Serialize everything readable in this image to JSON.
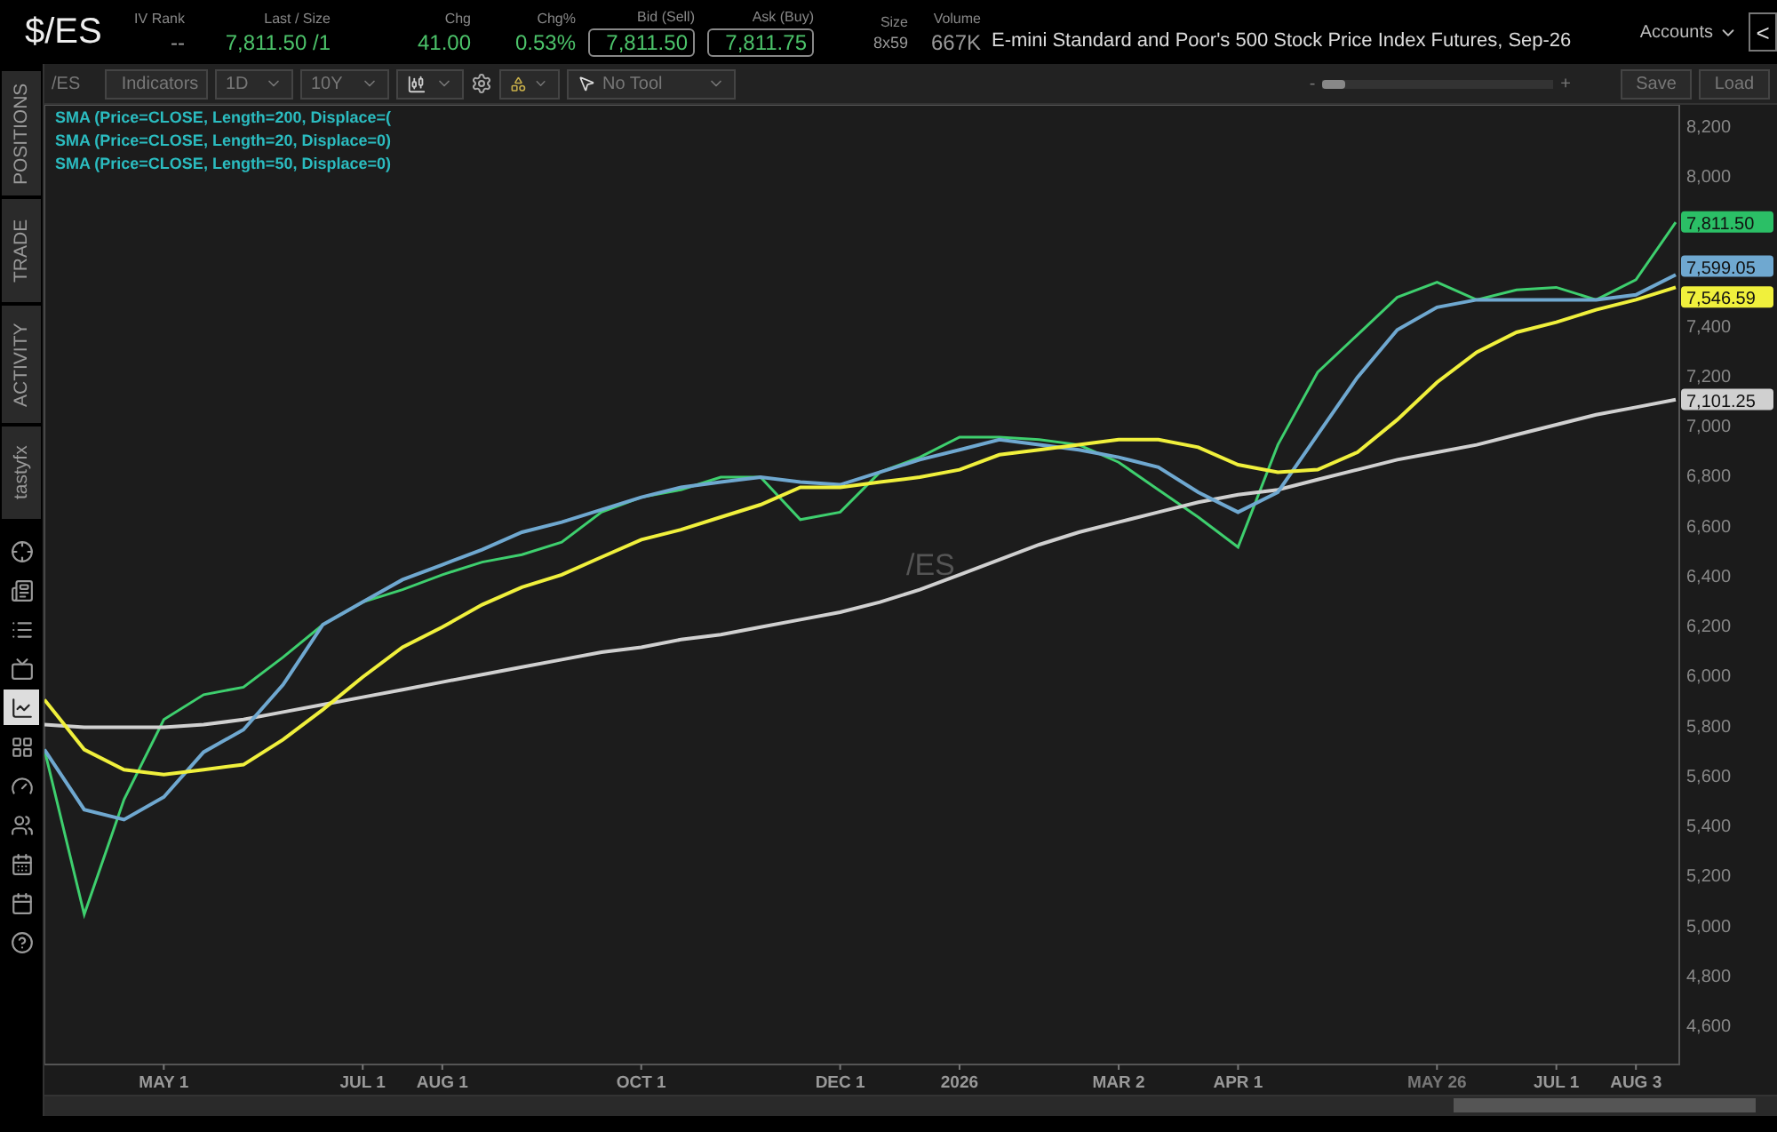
{
  "header": {
    "symbol": "$/ES",
    "stats": [
      {
        "label": "IV Rank",
        "value": "--",
        "kind": "plain"
      },
      {
        "label": "Last / Size",
        "value": "7,811.50 /1",
        "kind": "up"
      },
      {
        "label": "Chg",
        "value": "41.00",
        "kind": "up"
      },
      {
        "label": "Chg%",
        "value": "0.53%",
        "kind": "up"
      },
      {
        "label": "Bid (Sell)",
        "value": "7,811.50",
        "kind": "boxed"
      },
      {
        "label": "Ask (Buy)",
        "value": "7,811.75",
        "kind": "boxed"
      },
      {
        "label": "Size",
        "value": "8x59",
        "kind": "small"
      },
      {
        "label": "Volume",
        "value": "667K",
        "kind": "plain"
      }
    ],
    "description": "E-mini Standard and Poor's 500 Stock Price Index Futures, Sep-26",
    "accounts": "Accounts",
    "collapse": "<"
  },
  "side_tabs": [
    {
      "label": "POSITIONS",
      "selected": false
    },
    {
      "label": "TRADE",
      "selected": false
    },
    {
      "label": "ACTIVITY",
      "selected": false
    },
    {
      "label": "tastyfx",
      "selected": false
    }
  ],
  "side_icons": [
    {
      "kind": "crosshair",
      "selected": false
    },
    {
      "kind": "news",
      "selected": false
    },
    {
      "kind": "list",
      "selected": false
    },
    {
      "kind": "tv",
      "selected": false
    },
    {
      "kind": "chart",
      "selected": true
    },
    {
      "kind": "grid",
      "selected": false
    },
    {
      "kind": "gauge",
      "selected": false
    },
    {
      "kind": "people",
      "selected": false
    },
    {
      "kind": "calendar",
      "selected": false
    },
    {
      "kind": "calendar2",
      "selected": false
    },
    {
      "kind": "help",
      "selected": false
    }
  ],
  "toolbar": {
    "symbol": "/ES",
    "indicators": "Indicators",
    "interval": "1D",
    "range": "10Y",
    "tool": "No Tool",
    "zoom": {
      "level": 0.1,
      "minus": "-",
      "plus": "+"
    },
    "save": "Save",
    "load": "Load"
  },
  "chart": {
    "symbol_label": "/ES",
    "price_labels": [
      {
        "text": "7,811.50",
        "color": "#2bbf66"
      },
      {
        "text": "7,599.05",
        "color": "#6fa8d0"
      },
      {
        "text": "7,546.59",
        "color": "#f0f03c"
      },
      {
        "text": "7,101.25",
        "color": "#d0d0d0"
      }
    ],
    "chart_data": {
      "type": "line",
      "categories": [
        null,
        null,
        null,
        "MAY 1",
        null,
        null,
        null,
        null,
        "JUL 1",
        null,
        "AUG 1",
        null,
        null,
        null,
        null,
        "OCT 1",
        null,
        null,
        null,
        null,
        "DEC 1",
        null,
        null,
        "2026",
        null,
        null,
        null,
        "MAR 2",
        null,
        null,
        "APR 1",
        null,
        null,
        null,
        null,
        "MAY 26",
        null,
        null,
        "JUL 1",
        null,
        "AUG 3",
        null
      ],
      "series": [
        {
          "color": "#3ecf6e",
          "values": [
            5700,
            5040,
            5500,
            5820,
            5920,
            5950,
            6070,
            6200,
            6290,
            6340,
            6400,
            6450,
            6480,
            6530,
            6650,
            6710,
            6740,
            6790,
            6790,
            6620,
            6650,
            6810,
            6870,
            6950,
            6950,
            6940,
            6920,
            6850,
            6740,
            6630,
            6510,
            6920,
            7210,
            7360,
            7510,
            7570,
            7500,
            7540,
            7550,
            7500,
            7580,
            7810
          ]
        },
        {
          "name": "SMA (Price=CLOSE, Length=200, Displace=(",
          "color": "#d0d0d0",
          "values": [
            5800,
            5790,
            5790,
            5790,
            5800,
            5820,
            5850,
            5880,
            5910,
            5940,
            5970,
            6000,
            6030,
            6060,
            6090,
            6110,
            6140,
            6160,
            6190,
            6220,
            6250,
            6290,
            6340,
            6400,
            6460,
            6520,
            6570,
            6610,
            6650,
            6690,
            6720,
            6740,
            6780,
            6820,
            6860,
            6890,
            6920,
            6960,
            7000,
            7040,
            7070,
            7100
          ]
        },
        {
          "name": "SMA (Price=CLOSE, Length=20, Displace=0)",
          "color": "#6fa8d0",
          "values": [
            5700,
            5460,
            5420,
            5510,
            5690,
            5780,
            5960,
            6200,
            6290,
            6380,
            6440,
            6500,
            6570,
            6610,
            6660,
            6710,
            6750,
            6770,
            6790,
            6770,
            6760,
            6810,
            6860,
            6900,
            6940,
            6920,
            6900,
            6870,
            6830,
            6730,
            6650,
            6730,
            6960,
            7190,
            7380,
            7470,
            7500,
            7500,
            7500,
            7500,
            7520,
            7600
          ]
        },
        {
          "name": "SMA (Price=CLOSE, Length=50, Displace=0)",
          "color": "#f0f03c",
          "values": [
            5900,
            5700,
            5620,
            5600,
            5620,
            5640,
            5740,
            5860,
            5990,
            6110,
            6190,
            6280,
            6350,
            6400,
            6470,
            6540,
            6580,
            6630,
            6680,
            6750,
            6750,
            6770,
            6790,
            6820,
            6880,
            6900,
            6920,
            6940,
            6940,
            6910,
            6840,
            6810,
            6820,
            6890,
            7020,
            7170,
            7290,
            7370,
            7410,
            7460,
            7500,
            7550
          ]
        }
      ],
      "ylim": [
        4440,
        8280
      ],
      "yticks": [
        {
          "value": 4600,
          "label": "4,600"
        },
        {
          "value": 4800,
          "label": "4,800"
        },
        {
          "value": 5000,
          "label": "5,000"
        },
        {
          "value": 5200,
          "label": "5,200"
        },
        {
          "value": 5400,
          "label": "5,400"
        },
        {
          "value": 5600,
          "label": "5,600"
        },
        {
          "value": 5800,
          "label": "5,800"
        },
        {
          "value": 6000,
          "label": "6,000"
        },
        {
          "value": 6200,
          "label": "6,200"
        },
        {
          "value": 6400,
          "label": "6,400"
        },
        {
          "value": 6600,
          "label": "6,600"
        },
        {
          "value": 6800,
          "label": "6,800"
        },
        {
          "value": 7000,
          "label": "7,000"
        },
        {
          "value": 7200,
          "label": "7,200"
        },
        {
          "value": 7400,
          "label": "7,400"
        },
        {
          "value": 8000,
          "label": "8,000"
        },
        {
          "value": 8200,
          "label": "8,200"
        }
      ]
    }
  }
}
